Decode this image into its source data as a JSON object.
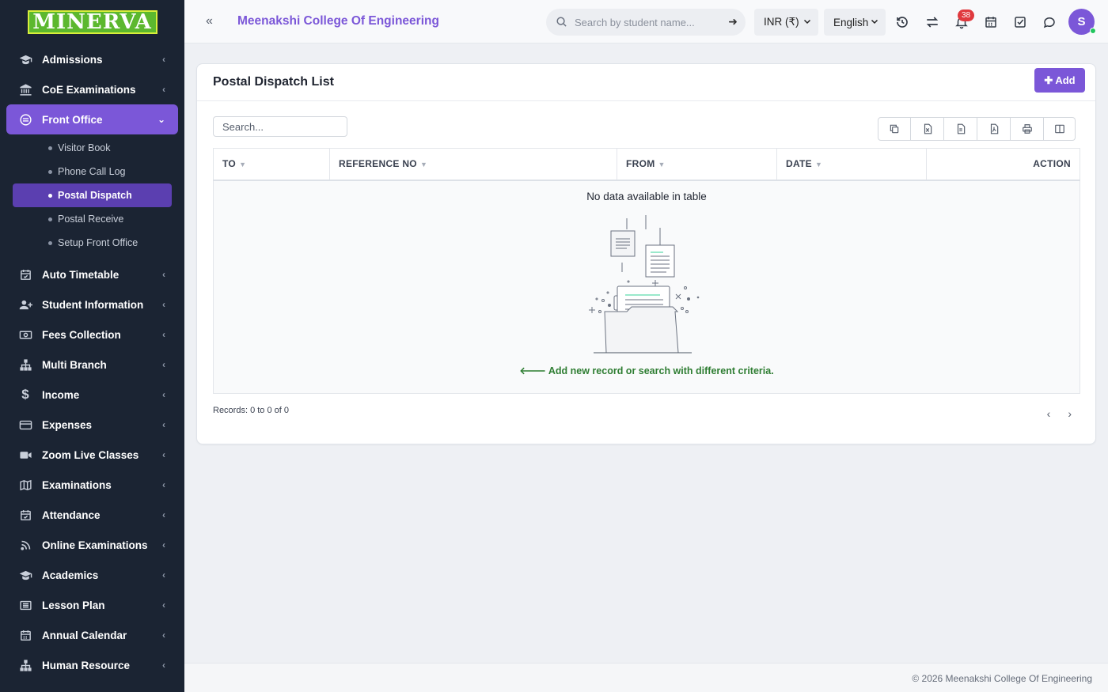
{
  "sidebar": {
    "logo": "MINERVA",
    "items": [
      {
        "label": "Admissions",
        "icon": "graduation-cap-icon"
      },
      {
        "label": "CoE Examinations",
        "icon": "bank-icon"
      },
      {
        "label": "Front Office",
        "icon": "front-office-icon",
        "active": true,
        "children": [
          {
            "label": "Visitor Book"
          },
          {
            "label": "Phone Call Log"
          },
          {
            "label": "Postal Dispatch",
            "active": true
          },
          {
            "label": "Postal Receive"
          },
          {
            "label": "Setup Front Office"
          }
        ]
      },
      {
        "label": "Auto Timetable",
        "icon": "calendar-check-icon"
      },
      {
        "label": "Student Information",
        "icon": "user-plus-icon"
      },
      {
        "label": "Fees Collection",
        "icon": "money-icon"
      },
      {
        "label": "Multi Branch",
        "icon": "sitemap-icon"
      },
      {
        "label": "Income",
        "icon": "dollar-icon"
      },
      {
        "label": "Expenses",
        "icon": "credit-card-icon"
      },
      {
        "label": "Zoom Live Classes",
        "icon": "video-icon"
      },
      {
        "label": "Examinations",
        "icon": "map-icon"
      },
      {
        "label": "Attendance",
        "icon": "calendar-check-icon"
      },
      {
        "label": "Online Examinations",
        "icon": "rss-icon"
      },
      {
        "label": "Academics",
        "icon": "graduation-cap-icon"
      },
      {
        "label": "Lesson Plan",
        "icon": "list-alt-icon"
      },
      {
        "label": "Annual Calendar",
        "icon": "calendar-icon"
      },
      {
        "label": "Human Resource",
        "icon": "sitemap-icon"
      }
    ]
  },
  "header": {
    "college_name": "Meenakshi College Of Engineering",
    "search_placeholder": "Search by student name...",
    "currency": "INR (₹)",
    "language": "English",
    "notification_count": "38",
    "avatar_initial": "S"
  },
  "main": {
    "title": "Postal Dispatch List",
    "add_label": "Add",
    "search_placeholder": "Search...",
    "columns": [
      "TO",
      "REFERENCE NO",
      "FROM",
      "DATE",
      "ACTION"
    ],
    "empty_text": "No data available in table",
    "empty_hint": "Add new record or search with different criteria.",
    "records_text": "Records: 0 to 0 of 0"
  },
  "footer": {
    "copyright": "© 2026 Meenakshi College Of Engineering"
  },
  "colors": {
    "accent": "#7b57d8",
    "sidebar_bg": "#1b2433",
    "success_text": "#2e7d32",
    "badge": "#e0393e"
  }
}
